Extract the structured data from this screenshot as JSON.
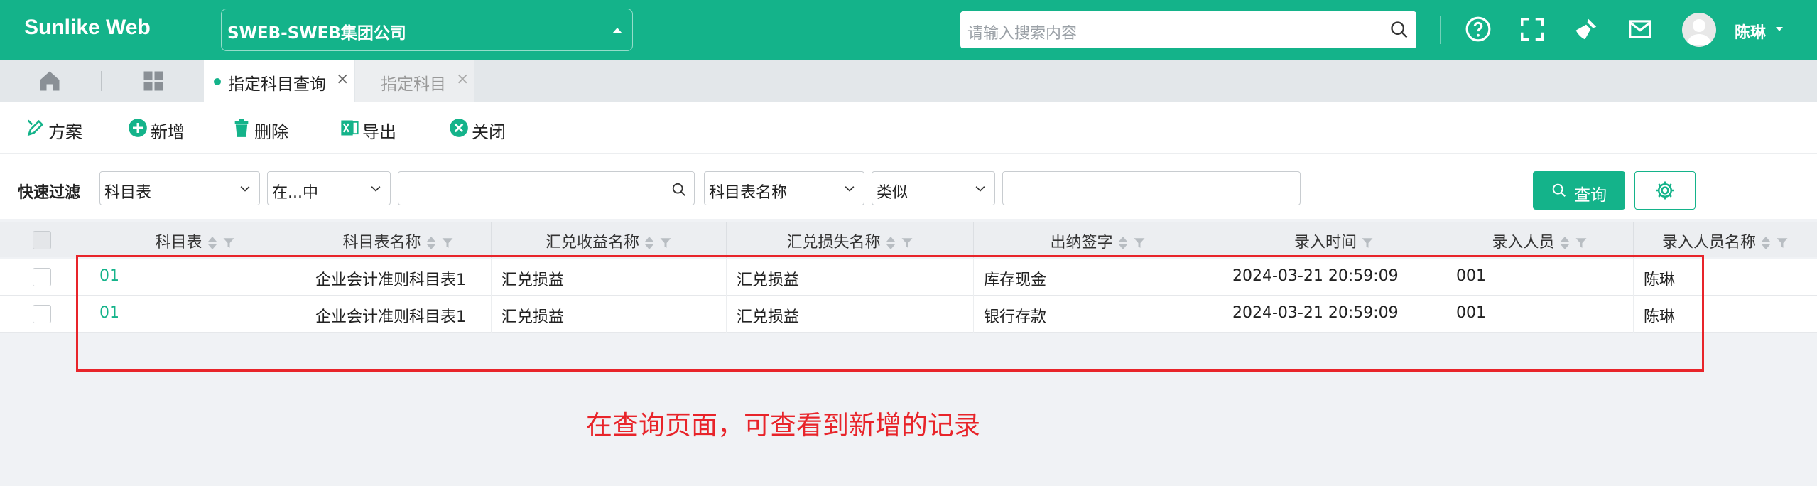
{
  "header": {
    "brand": "Sunlike Web",
    "company": "SWEB-SWEB集团公司",
    "search_placeholder": "请输入搜索内容",
    "user_name": "陈琳",
    "accent": "#14b38a"
  },
  "tabs": {
    "active_label": "指定科目查询",
    "inactive_label": "指定科目",
    "close_glyph": "×"
  },
  "toolbar": {
    "plan": "方案",
    "add": "新增",
    "delete": "删除",
    "export": "导出",
    "close": "关闭"
  },
  "filter": {
    "label": "快速过滤",
    "field1": "科目表",
    "op1": "在...中",
    "value1": "",
    "field2": "科目表名称",
    "op2": "类似",
    "value2": "",
    "query_button": "查询"
  },
  "grid": {
    "columns": [
      "科目表",
      "科目表名称",
      "汇兑收益名称",
      "汇兑损失名称",
      "出纳签字",
      "录入时间",
      "录入人员",
      "录入人员名称"
    ],
    "rows": [
      [
        "01",
        "企业会计准则科目表1",
        "汇兑损益",
        "汇兑损益",
        "库存现金",
        "2024-03-21 20:59:09",
        "001",
        "陈琳"
      ],
      [
        "01",
        "企业会计准则科目表1",
        "汇兑损益",
        "汇兑损益",
        "银行存款",
        "2024-03-21 20:59:09",
        "001",
        "陈琳"
      ]
    ]
  },
  "annotation": "在查询页面，可查看到新增的记录",
  "annotation_color": "#e8242a"
}
